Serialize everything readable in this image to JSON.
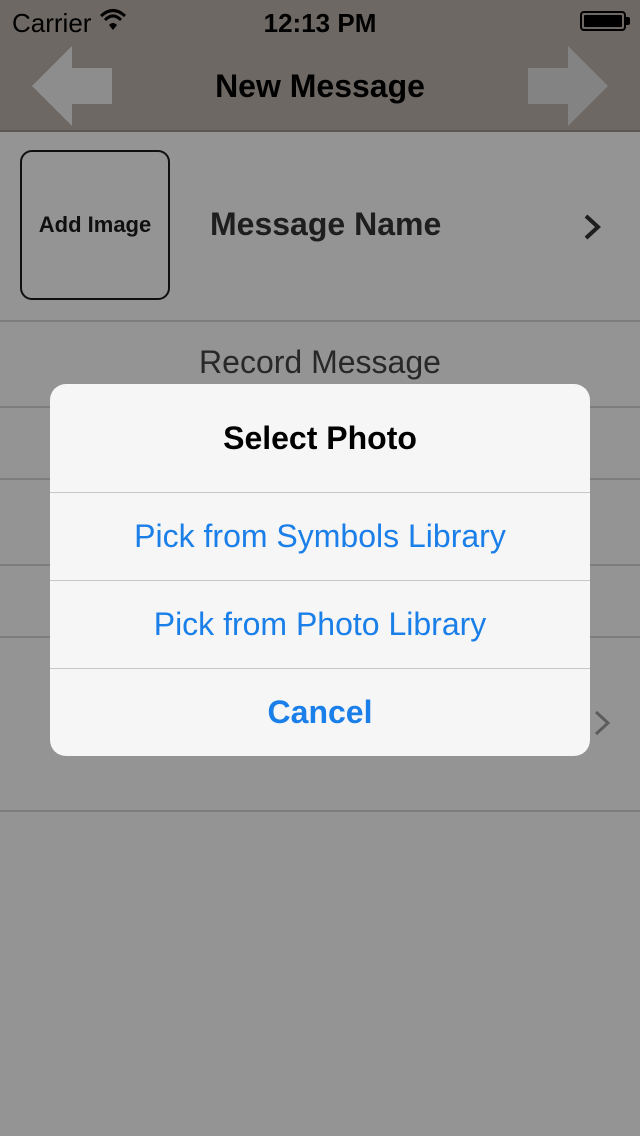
{
  "status_bar": {
    "carrier": "Carrier",
    "time": "12:13 PM"
  },
  "nav": {
    "title": "New Message"
  },
  "form": {
    "add_image_label": "Add Image",
    "message_name_label": "Message Name",
    "record_message_label": "Record Message"
  },
  "alert": {
    "title": "Select Photo",
    "buttons": [
      "Pick from Symbols Library",
      "Pick from Photo Library",
      "Cancel"
    ]
  },
  "colors": {
    "nav_bar": "#b6ada6",
    "alert_button": "#1a7fe8",
    "overlay": "rgba(0,0,0,0.40)"
  },
  "icons": {
    "back": "left-arrow-icon",
    "forward": "right-arrow-icon",
    "disclosure": "chevron-right-icon"
  }
}
